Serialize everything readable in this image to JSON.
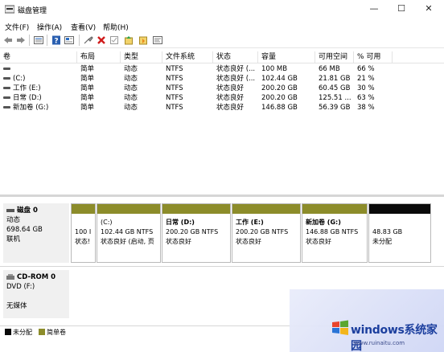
{
  "window": {
    "title": "磁盘管理",
    "controls": [
      "—",
      "☐",
      "✕"
    ]
  },
  "menu": [
    "文件(F)",
    "操作(A)",
    "查看(V)",
    "帮助(H)"
  ],
  "toolbar_icons": [
    "back-icon",
    "forward-icon",
    "list-icon",
    "help-icon",
    "properties-icon",
    "connect-icon",
    "delete-icon",
    "check-icon",
    "new-volume-icon",
    "rescan-icon",
    "refresh-icon"
  ],
  "volume_table": {
    "columns": [
      "卷",
      "布局",
      "类型",
      "文件系统",
      "状态",
      "容量",
      "可用空间",
      "% 可用"
    ],
    "rows": [
      {
        "volume": "",
        "layout": "简单",
        "type": "动态",
        "fs": "NTFS",
        "status": "状态良好 (...",
        "capacity": "100 MB",
        "free": "66 MB",
        "pct": "66 %"
      },
      {
        "volume": "(C:)",
        "layout": "简单",
        "type": "动态",
        "fs": "NTFS",
        "status": "状态良好 (...",
        "capacity": "102.44 GB",
        "free": "21.81 GB",
        "pct": "21 %"
      },
      {
        "volume": "工作 (E:)",
        "layout": "简单",
        "type": "动态",
        "fs": "NTFS",
        "status": "状态良好",
        "capacity": "200.20 GB",
        "free": "60.45 GB",
        "pct": "30 %"
      },
      {
        "volume": "日常 (D:)",
        "layout": "简单",
        "type": "动态",
        "fs": "NTFS",
        "status": "状态良好",
        "capacity": "200.20 GB",
        "free": "125.51 ...",
        "pct": "63 %"
      },
      {
        "volume": "新加卷 (G:)",
        "layout": "简单",
        "type": "动态",
        "fs": "NTFS",
        "status": "状态良好",
        "capacity": "146.88 GB",
        "free": "56.39 GB",
        "pct": "38 %"
      }
    ]
  },
  "disk0": {
    "name": "磁盘 0",
    "type": "动态",
    "size": "698.64 GB",
    "state": "联机",
    "partitions": [
      {
        "line1": "",
        "line2": "100 I",
        "line3": "状态!"
      },
      {
        "line1": "(C:)",
        "line2": "102.44 GB NTFS",
        "line3": "状态良好 (启动, 页"
      },
      {
        "line1": "日常  (D:)",
        "line2": "200.20 GB NTFS",
        "line3": "状态良好"
      },
      {
        "line1": "工作  (E:)",
        "line2": "200.20 GB NTFS",
        "line3": "状态良好"
      },
      {
        "line1": "新加卷  (G:)",
        "line2": "146.88 GB NTFS",
        "line3": "状态良好"
      },
      {
        "line1": "",
        "line2": "48.83 GB",
        "line3": "未分配"
      }
    ]
  },
  "cdrom0": {
    "name": "CD-ROM 0",
    "drive": "DVD (F:)",
    "media": "无媒体"
  },
  "legend": [
    {
      "label": "未分配",
      "color": "#0a0a0a"
    },
    {
      "label": "简单卷",
      "color": "#8c8c2a"
    }
  ],
  "watermark": {
    "title": "windows系统家园",
    "url": "www.ruinaitu.com"
  }
}
